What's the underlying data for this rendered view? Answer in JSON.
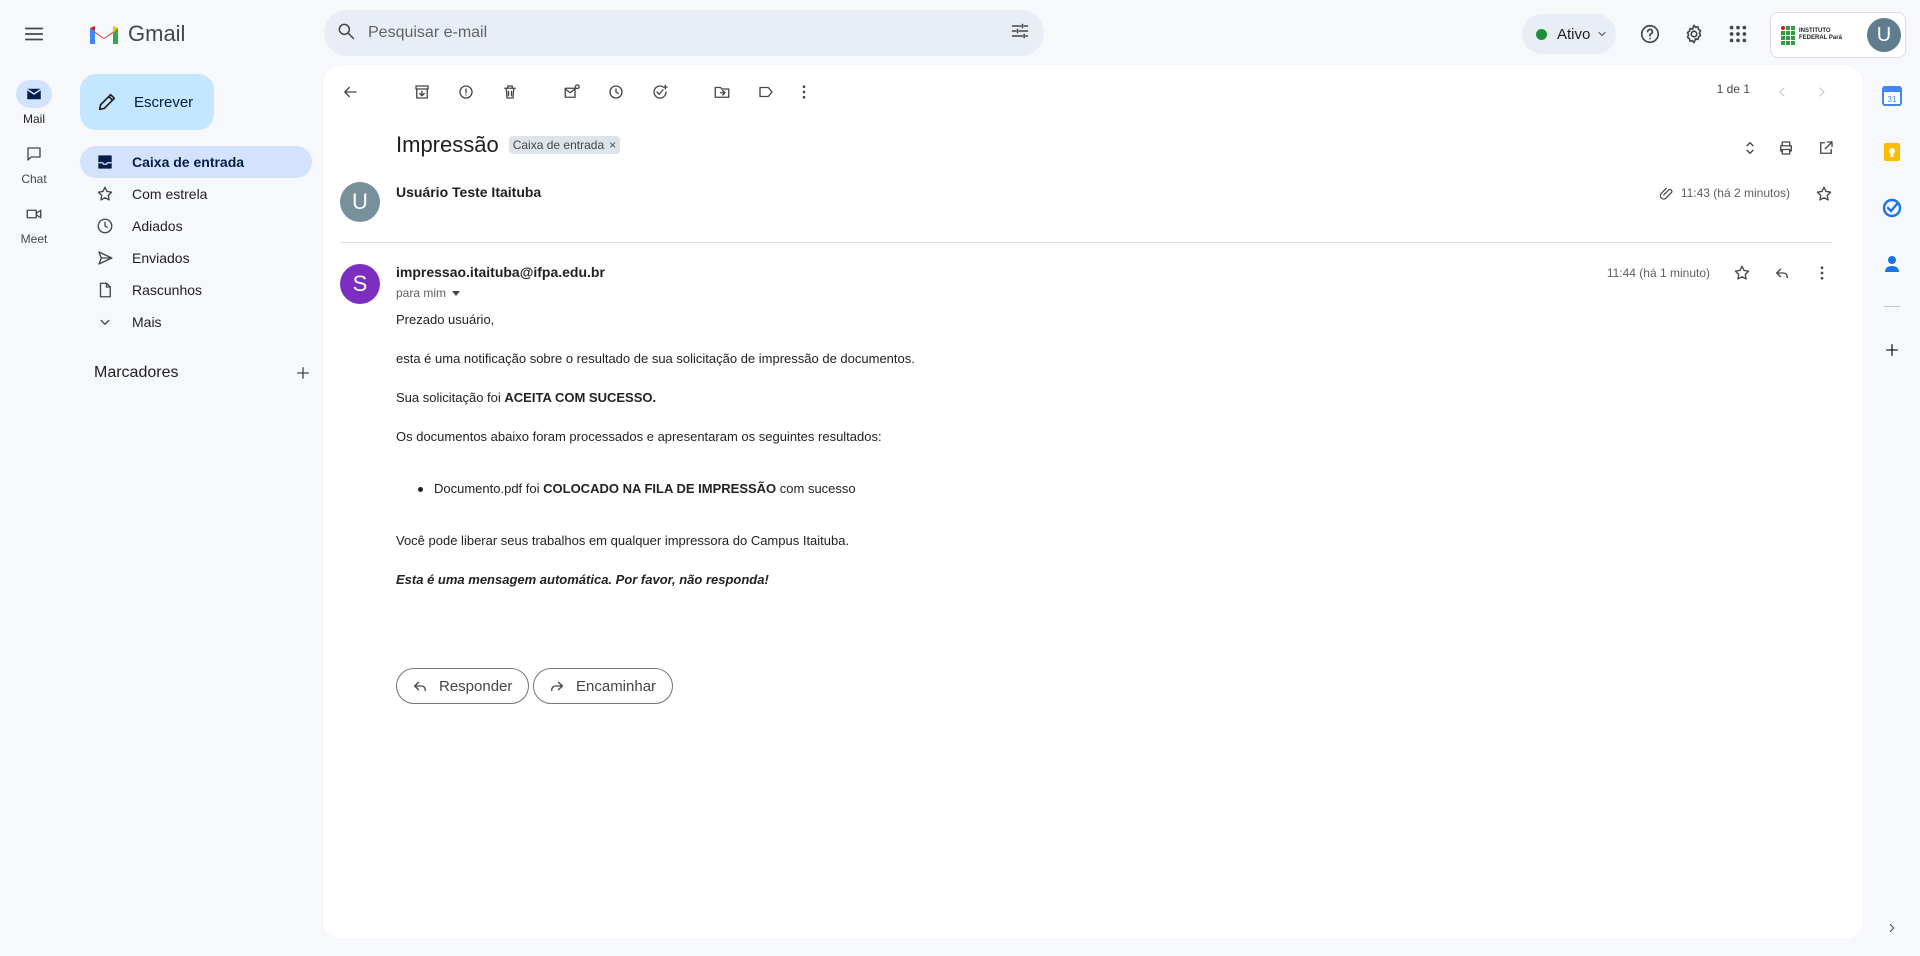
{
  "app": {
    "name": "Gmail"
  },
  "search": {
    "placeholder": "Pesquisar e-mail"
  },
  "status": {
    "label": "Ativo"
  },
  "account": {
    "org_name": "INSTITUTO FEDERAL Pará",
    "avatar_letter": "U"
  },
  "rail": [
    {
      "label": "Mail",
      "icon": "mail-icon",
      "active": true
    },
    {
      "label": "Chat",
      "icon": "chat-icon",
      "active": false
    },
    {
      "label": "Meet",
      "icon": "meet-icon",
      "active": false
    }
  ],
  "compose": {
    "label": "Escrever"
  },
  "nav": [
    {
      "label": "Caixa de entrada",
      "icon": "inbox-icon",
      "active": true
    },
    {
      "label": "Com estrela",
      "icon": "star-icon",
      "active": false
    },
    {
      "label": "Adiados",
      "icon": "clock-icon",
      "active": false
    },
    {
      "label": "Enviados",
      "icon": "send-icon",
      "active": false
    },
    {
      "label": "Rascunhos",
      "icon": "draft-icon",
      "active": false
    },
    {
      "label": "Mais",
      "icon": "chevron-down-icon",
      "active": false
    }
  ],
  "labels": {
    "title": "Marcadores"
  },
  "pager": {
    "text": "1 de 1"
  },
  "thread": {
    "subject": "Impressão",
    "chip": "Caixa de entrada",
    "messages": [
      {
        "sender": "Usuário Teste Itaituba",
        "avatar": "U",
        "avatar_color": "#78909c",
        "time": "11:43 (há 2 minutos)",
        "has_attachment": true
      },
      {
        "sender": "impressao.itaituba@ifpa.edu.br",
        "avatar": "S",
        "avatar_color": "#7b2ebf",
        "to": "para mim",
        "time": "11:44 (há 1 minuto)",
        "body": {
          "greeting": "Prezado usuário,",
          "intro": "esta é uma notificação sobre o resultado de sua solicitação de impressão de documentos.",
          "status_prefix": "Sua solicitação foi ",
          "status_value": "ACEITA COM SUCESSO.",
          "results_intro": "Os documentos abaixo foram processados e apresentaram os seguintes resultados:",
          "item_file": "Documento.pdf foi ",
          "item_status": "COLOCADO NA FILA DE IMPRESSÃO",
          "item_suffix": " com sucesso",
          "release": "Você pode liberar seus trabalhos em qualquer impressora do Campus Itaituba.",
          "footer": "Esta é uma mensagem automática. Por favor, não responda!"
        }
      }
    ]
  },
  "actions": {
    "reply": "Responder",
    "forward": "Encaminhar"
  },
  "colors": {
    "accent": "#c2e7ff",
    "nav_active": "#d3e3fd",
    "status_green": "#1e8e3e"
  }
}
